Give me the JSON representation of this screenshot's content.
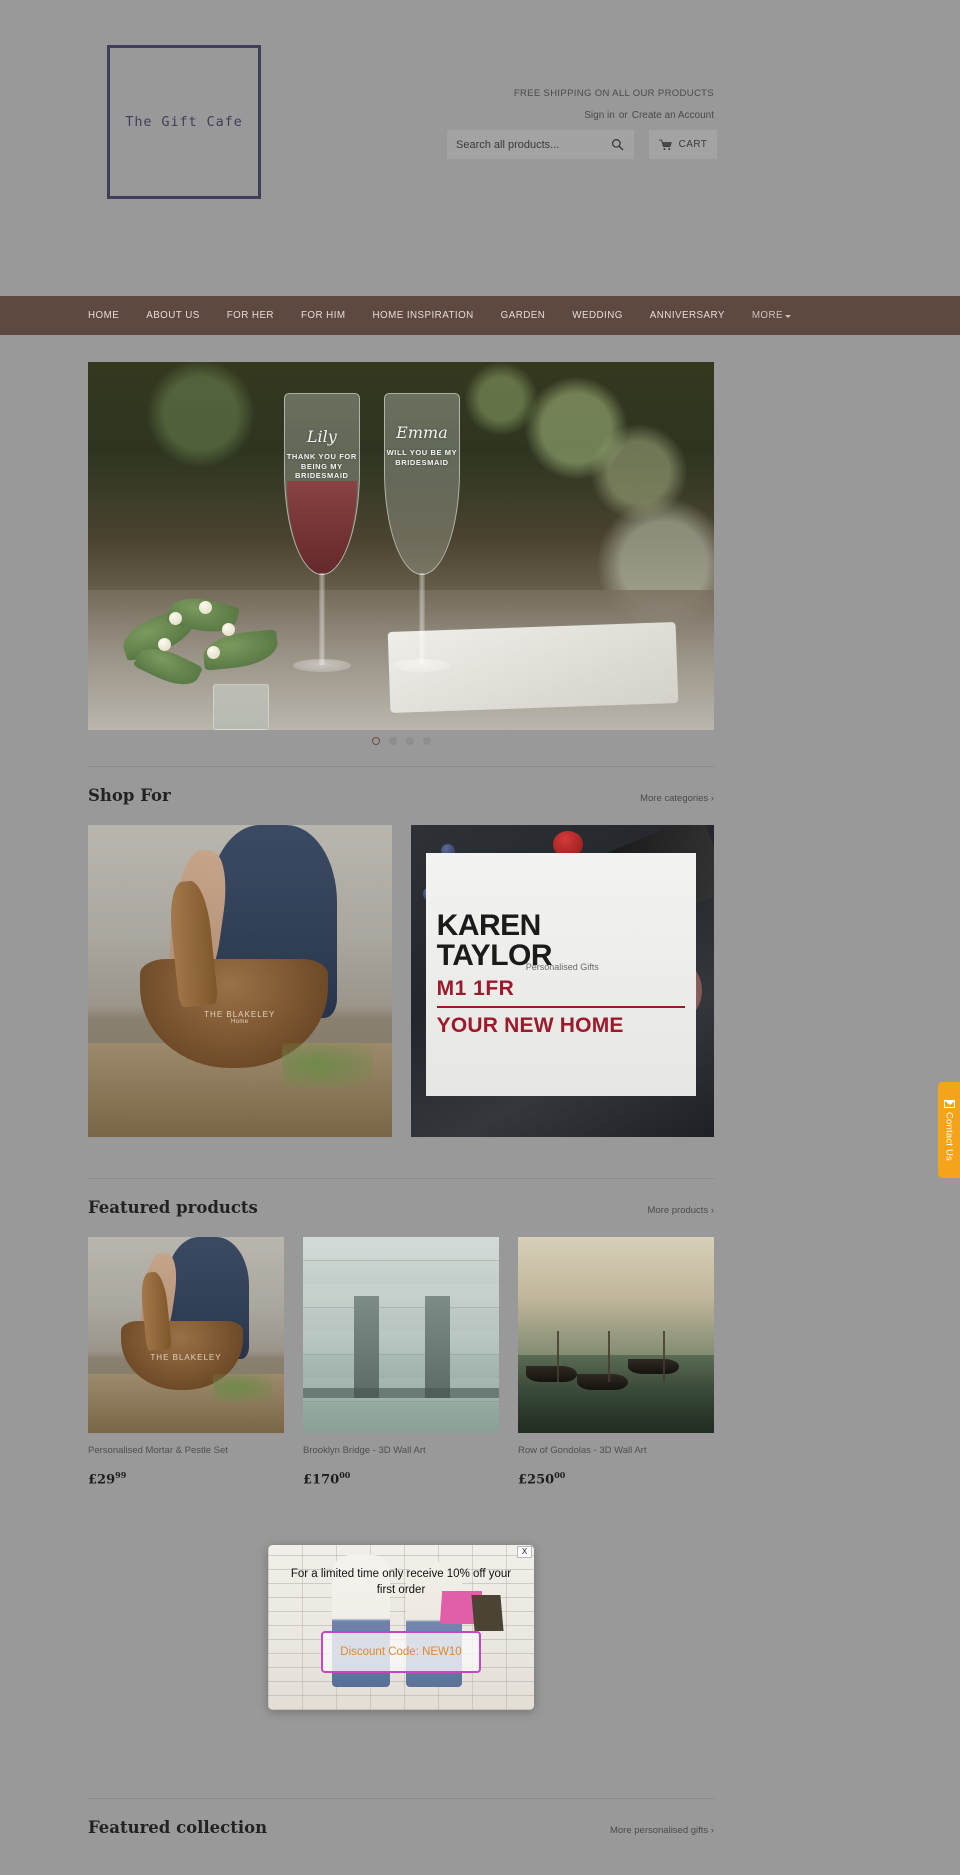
{
  "header": {
    "logo_text": "The Gift Cafe",
    "promo_banner": "FREE SHIPPING ON ALL OUR PRODUCTS",
    "sign_in_label": "Sign in",
    "or_label": "or",
    "create_account_label": "Create an Account",
    "search_placeholder": "Search all products...",
    "search_value": "",
    "search_icon": "search-icon",
    "cart_label": "CART",
    "cart_icon": "cart-icon"
  },
  "nav": {
    "items": [
      {
        "label": "HOME"
      },
      {
        "label": "ABOUT US"
      },
      {
        "label": "FOR HER"
      },
      {
        "label": "FOR HIM"
      },
      {
        "label": "HOME INSPIRATION"
      },
      {
        "label": "GARDEN"
      },
      {
        "label": "WEDDING"
      },
      {
        "label": "ANNIVERSARY"
      }
    ],
    "more_label": "MORE",
    "more_icon": "chevron-down-icon"
  },
  "hero": {
    "slide_alt": "Personalised bridesmaid champagne flutes",
    "glass_left": {
      "name": "Lily",
      "message": "THANK YOU FOR BEING MY BRIDESMAID"
    },
    "glass_right": {
      "name": "Emma",
      "message": "WILL YOU BE MY BRIDESMAID"
    },
    "dots": [
      {
        "active": true
      },
      {
        "active": false
      },
      {
        "active": false
      },
      {
        "active": false
      }
    ]
  },
  "shop_for": {
    "title": "Shop For",
    "link_label": "More categories ›",
    "cards": [
      {
        "name": "mortar-pestle-category",
        "brand": "THE BLAKELEY",
        "brand_sub": "Home"
      },
      {
        "name": "house-sign-category",
        "sign_line1": "KAREN",
        "sign_line2": "TAYLOR",
        "postcode": "M1 1FR",
        "sign_line3": "YOUR NEW HOME",
        "caption": "Personalised Gifts"
      }
    ]
  },
  "featured_products": {
    "title": "Featured products",
    "link_label": "More products ›",
    "products": [
      {
        "title": "Personalised Mortar & Pestle Set",
        "currency": "£",
        "price_main": "29",
        "price_cents": "99"
      },
      {
        "title": "Brooklyn Bridge - 3D Wall Art",
        "currency": "£",
        "price_main": "170",
        "price_cents": "00"
      },
      {
        "title": "Row of Gondolas - 3D Wall Art",
        "currency": "£",
        "price_main": "250",
        "price_cents": "00"
      }
    ]
  },
  "featured_collection": {
    "title": "Featured collection",
    "link_label": "More personalised gifts ›"
  },
  "popup": {
    "close_label": "X",
    "message": "For a limited time only receive 10% off your first order",
    "code_button_label": "Discount Code: NEW10"
  },
  "contact_tab": {
    "label": "Contact Us",
    "icon": "mail-icon"
  },
  "colors": {
    "nav_bar": "#5e4941",
    "logo_border": "#3f3f5c",
    "page_bg": "#999999",
    "contact_tab": "#f5a31a",
    "popup_border": "#c646c6",
    "popup_code_text": "#e08a2a",
    "sign_red": "#9c1a2b"
  }
}
